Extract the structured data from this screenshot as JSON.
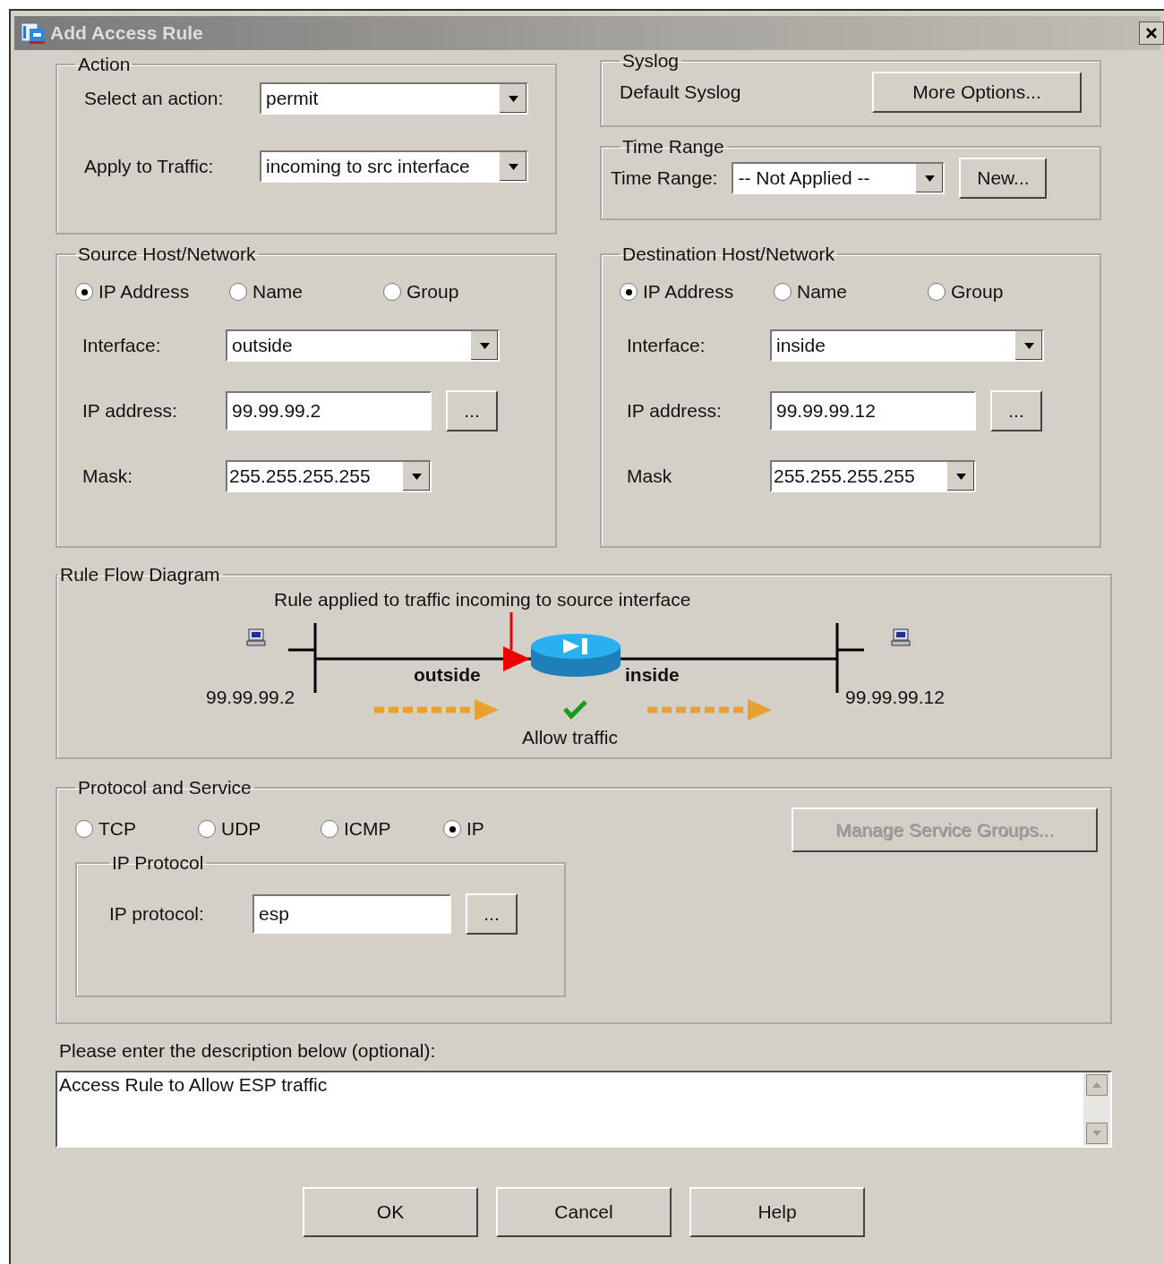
{
  "window": {
    "title": "Add Access Rule"
  },
  "action": {
    "title": "Action",
    "fields": [
      {
        "label": "Select an action:",
        "value": "permit"
      },
      {
        "label": "Apply to Traffic:",
        "value": "incoming to src interface"
      }
    ]
  },
  "syslog": {
    "title": "Syslog",
    "label": "Default Syslog",
    "button": "More Options..."
  },
  "time_range": {
    "title": "Time Range",
    "label": "Time Range:",
    "value": "-- Not Applied --",
    "button": "New..."
  },
  "source": {
    "title": "Source Host/Network",
    "options": [
      {
        "label": "IP Address",
        "selected": true
      },
      {
        "label": "Name",
        "selected": false
      },
      {
        "label": "Group",
        "selected": false
      }
    ],
    "interface": {
      "label": "Interface:",
      "value": "outside"
    },
    "ip": {
      "label": "IP address:",
      "value": "99.99.99.2",
      "button": "..."
    },
    "mask": {
      "label": "Mask:",
      "value": "255.255.255.255"
    }
  },
  "destination": {
    "title": "Destination Host/Network",
    "options": [
      {
        "label": "IP Address",
        "selected": true
      },
      {
        "label": "Name",
        "selected": false
      },
      {
        "label": "Group",
        "selected": false
      }
    ],
    "interface": {
      "label": "Interface:",
      "value": "inside"
    },
    "ip": {
      "label": "IP address:",
      "value": "99.99.99.12",
      "button": "..."
    },
    "mask": {
      "label": "Mask",
      "value": "255.255.255.255"
    }
  },
  "diagram": {
    "title": "Rule Flow Diagram",
    "caption": "Rule applied to traffic incoming to source interface",
    "source_ip": "99.99.99.2",
    "dest_ip": "99.99.99.12",
    "source_interface": "outside",
    "dest_interface": "inside",
    "result": "Allow traffic"
  },
  "protocol": {
    "title": "Protocol and Service",
    "options": [
      {
        "label": "TCP",
        "selected": false
      },
      {
        "label": "UDP",
        "selected": false
      },
      {
        "label": "ICMP",
        "selected": false
      },
      {
        "label": "IP",
        "selected": true
      }
    ],
    "button": {
      "label": "Manage Service Groups...",
      "disabled": true
    },
    "ip_protocol": {
      "title": "IP Protocol",
      "label": "IP protocol:",
      "value": "esp",
      "button": "..."
    }
  },
  "description": {
    "label": "Please enter the description below (optional):",
    "value": "Access Rule to Allow ESP traffic"
  },
  "buttons": [
    "OK",
    "Cancel",
    "Help"
  ]
}
